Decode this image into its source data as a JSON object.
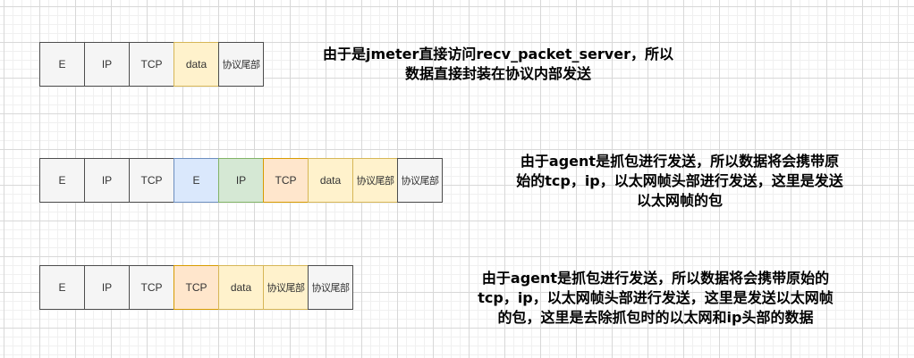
{
  "rows": [
    {
      "cells": [
        {
          "label": "E",
          "color": "#f5f5f5"
        },
        {
          "label": "IP",
          "color": "#f5f5f5"
        },
        {
          "label": "TCP",
          "color": "#f5f5f5"
        },
        {
          "label": "data",
          "color": "#fff2cc"
        },
        {
          "label": "协议尾部",
          "color": "#f5f5f5"
        }
      ],
      "note": {
        "line1": "由于是jmeter直接访问recv_packet_server，所以",
        "line2": "数据直接封装在协议内部发送"
      }
    },
    {
      "cells": [
        {
          "label": "E",
          "color": "#f5f5f5"
        },
        {
          "label": "IP",
          "color": "#f5f5f5"
        },
        {
          "label": "TCP",
          "color": "#f5f5f5"
        },
        {
          "label": "E",
          "color": "#dae8fc"
        },
        {
          "label": "IP",
          "color": "#d5e8d4"
        },
        {
          "label": "TCP",
          "color": "#ffe6cc"
        },
        {
          "label": "data",
          "color": "#fff2cc"
        },
        {
          "label": "协议尾部",
          "color": "#fff2cc"
        },
        {
          "label": "协议尾部",
          "color": "#f5f5f5"
        }
      ],
      "note": {
        "line1": "由于agent是抓包进行发送，所以数据将会携带原",
        "line2": "始的tcp，ip，以太网帧头部进行发送，这里是发送",
        "line3": "以太网帧的包"
      }
    },
    {
      "cells": [
        {
          "label": "E",
          "color": "#f5f5f5"
        },
        {
          "label": "IP",
          "color": "#f5f5f5"
        },
        {
          "label": "TCP",
          "color": "#f5f5f5"
        },
        {
          "label": "TCP",
          "color": "#ffe6cc"
        },
        {
          "label": "data",
          "color": "#fff2cc"
        },
        {
          "label": "协议尾部",
          "color": "#fff2cc"
        },
        {
          "label": "协议尾部",
          "color": "#f5f5f5"
        }
      ],
      "note": {
        "line1": "由于agent是抓包进行发送，所以数据将会携带原始的",
        "line2": "tcp，ip，以太网帧头部进行发送，这里是发送以太网帧",
        "line3": "的包，这里是去除抓包时的以太网和ip头部的数据"
      }
    }
  ]
}
